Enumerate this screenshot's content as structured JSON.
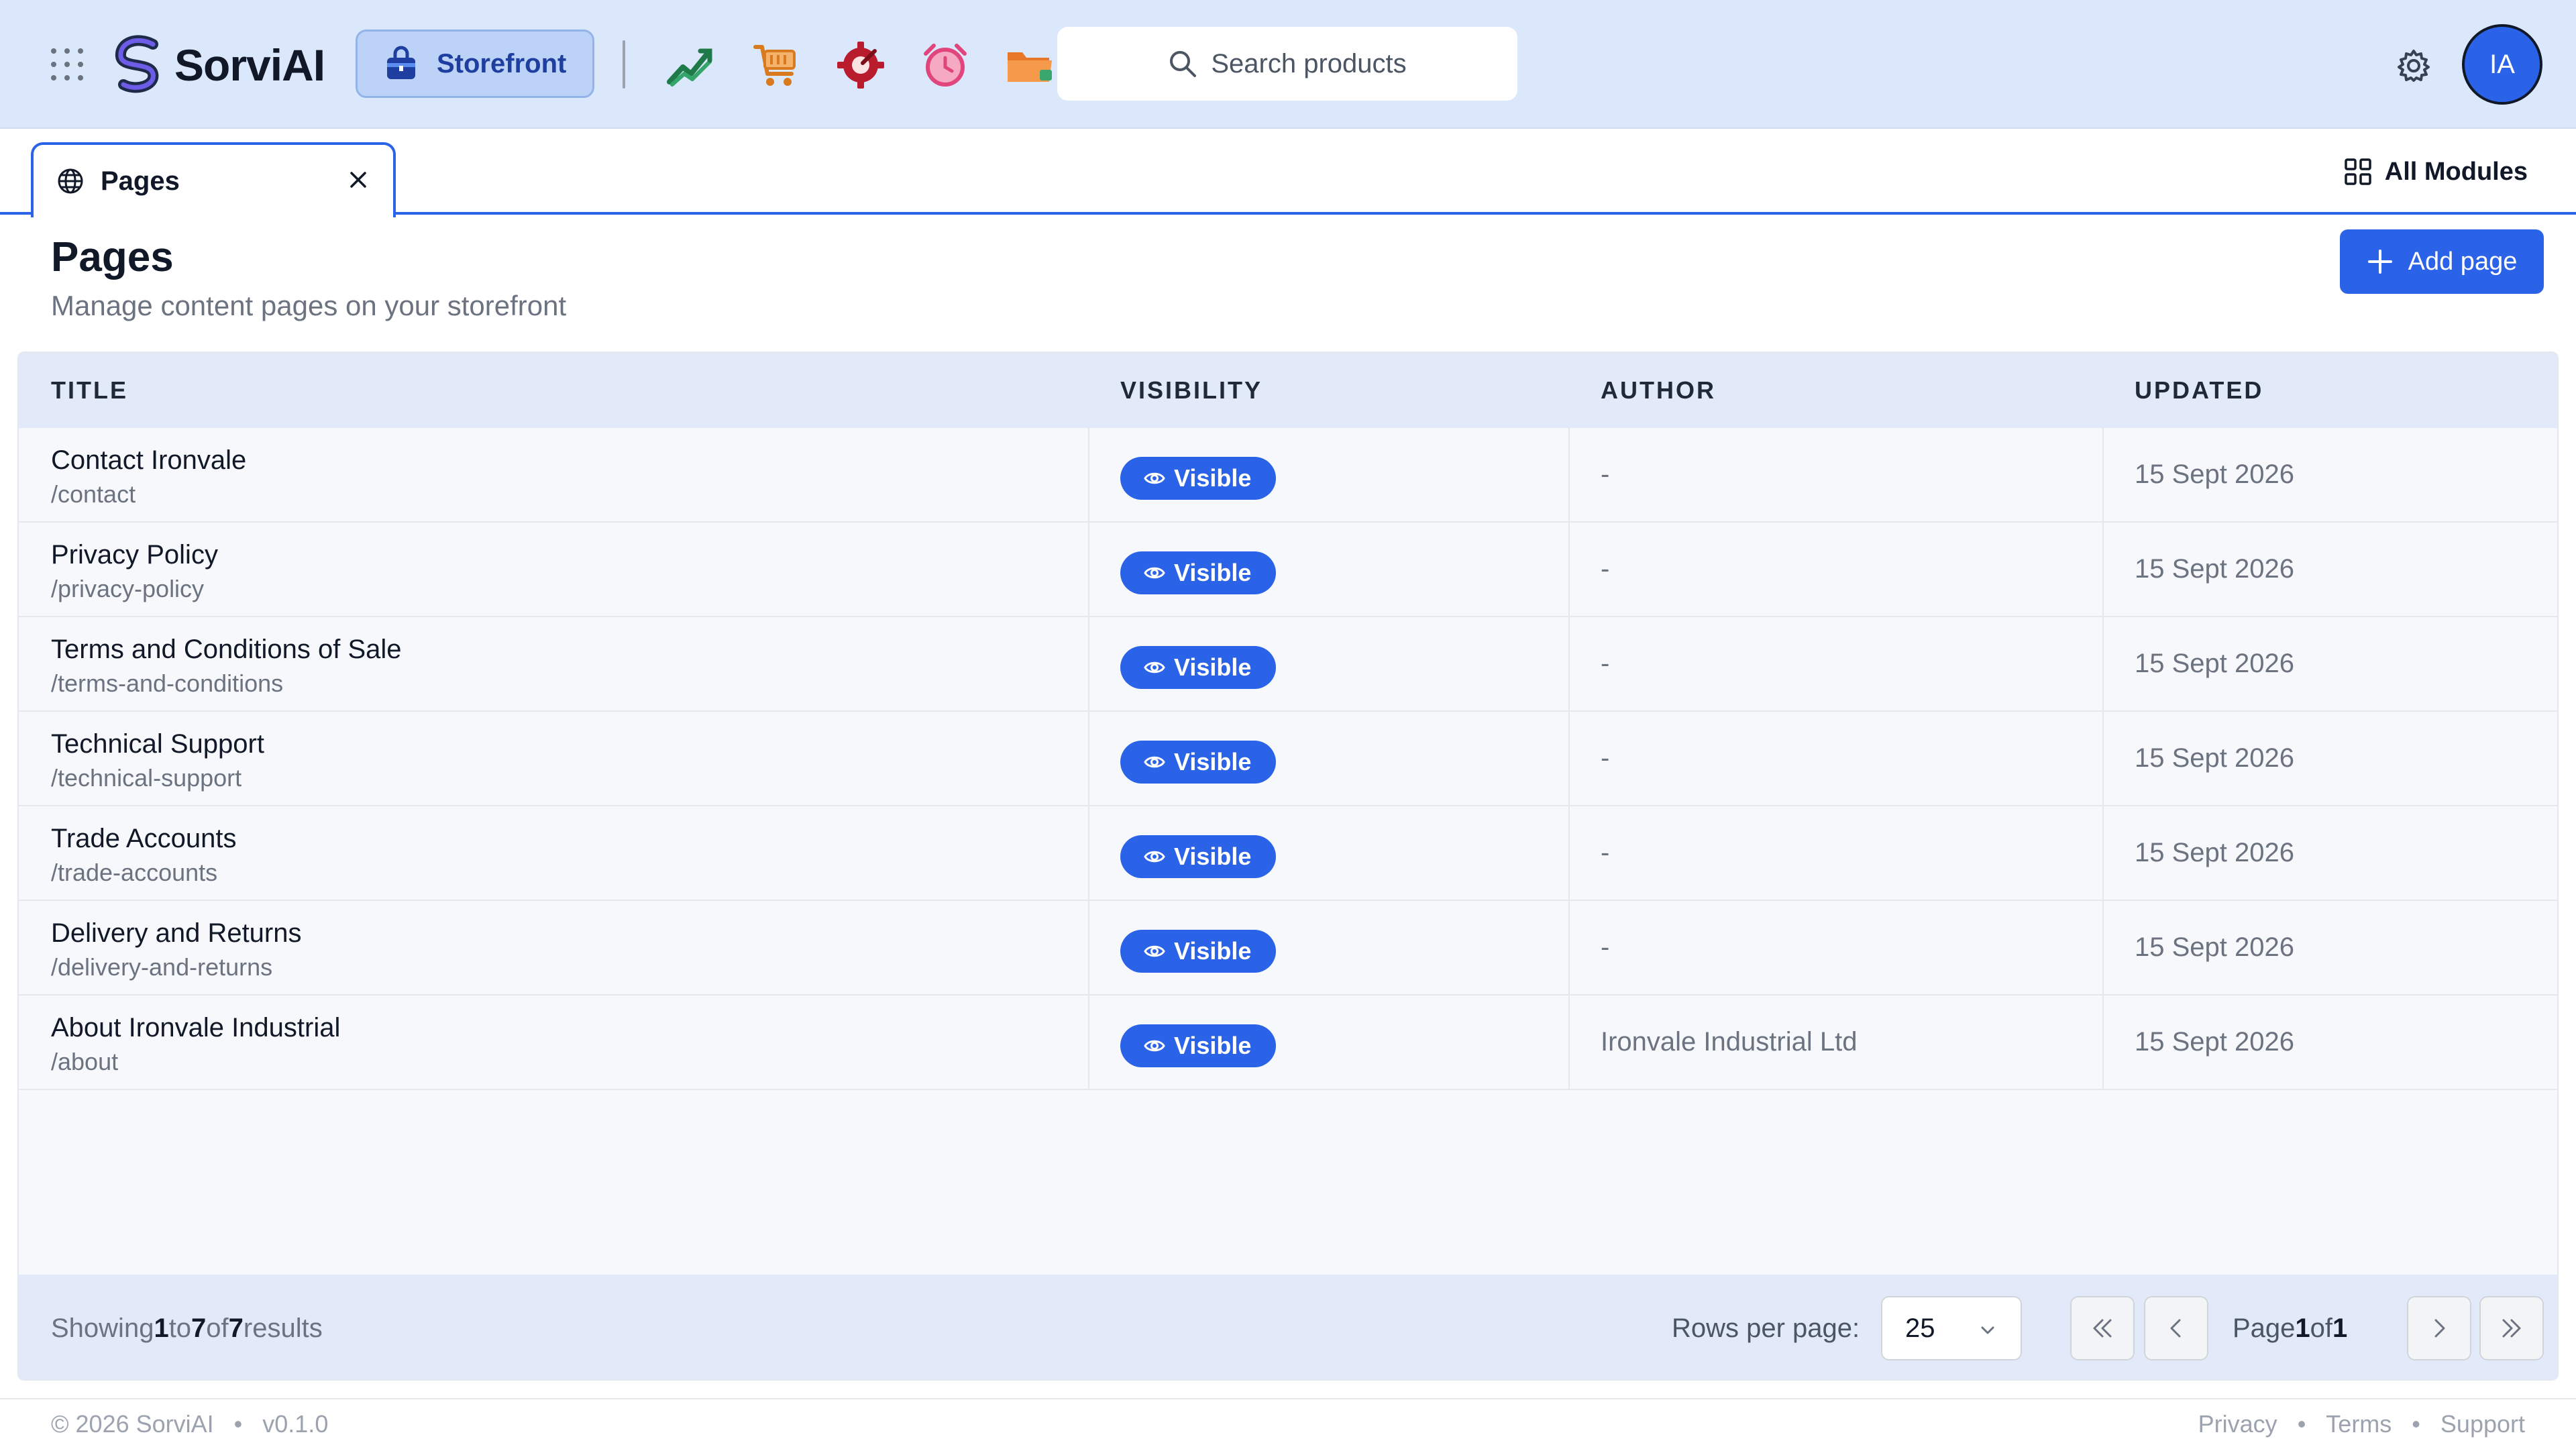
{
  "app": {
    "brand_name": "SorviAI",
    "active_module": "Storefront"
  },
  "nav": {
    "module_icons": [
      "sales-chart-icon",
      "shopping-cart-icon",
      "service-gear-icon",
      "alarm-clock-icon",
      "folder-icon"
    ],
    "search_placeholder": "Search products",
    "avatar_initials": "IA"
  },
  "tabs": [
    {
      "label": "Pages",
      "icon": "globe-icon"
    }
  ],
  "all_modules_label": "All Modules",
  "page": {
    "title": "Pages",
    "subtitle": "Manage content pages on your storefront",
    "add_button_label": "Add page"
  },
  "table": {
    "columns": [
      "TITLE",
      "VISIBILITY",
      "AUTHOR",
      "UPDATED"
    ],
    "rows": [
      {
        "title": "Contact Ironvale",
        "slug": "/contact",
        "visibility": "Visible",
        "author": "-",
        "updated": "15 Sept 2026"
      },
      {
        "title": "Privacy Policy",
        "slug": "/privacy-policy",
        "visibility": "Visible",
        "author": "-",
        "updated": "15 Sept 2026"
      },
      {
        "title": "Terms and Conditions of Sale",
        "slug": "/terms-and-conditions",
        "visibility": "Visible",
        "author": "-",
        "updated": "15 Sept 2026"
      },
      {
        "title": "Technical Support",
        "slug": "/technical-support",
        "visibility": "Visible",
        "author": "-",
        "updated": "15 Sept 2026"
      },
      {
        "title": "Trade Accounts",
        "slug": "/trade-accounts",
        "visibility": "Visible",
        "author": "-",
        "updated": "15 Sept 2026"
      },
      {
        "title": "Delivery and Returns",
        "slug": "/delivery-and-returns",
        "visibility": "Visible",
        "author": "-",
        "updated": "15 Sept 2026"
      },
      {
        "title": "About Ironvale Industrial",
        "slug": "/about",
        "visibility": "Visible",
        "author": "Ironvale Industrial Ltd",
        "updated": "15 Sept 2026"
      }
    ]
  },
  "pagination": {
    "showing_prefix": "Showing",
    "showing_from": "1",
    "showing_to_word": "to",
    "showing_to": "7",
    "showing_of_word": "of",
    "showing_total": "7",
    "showing_suffix": "results",
    "rows_per_page_label": "Rows per page:",
    "rows_per_page_value": "25",
    "page_word": "Page",
    "current_page": "1",
    "of_word": "of",
    "total_pages": "1"
  },
  "footer": {
    "copyright": "© 2026 SorviAI",
    "version": "v0.1.0",
    "links": [
      "Privacy",
      "Terms",
      "Support"
    ]
  },
  "colors": {
    "primary": "#2b63e8",
    "nav_bg": "#dbe8fb",
    "header_bg": "#e2eafa"
  }
}
